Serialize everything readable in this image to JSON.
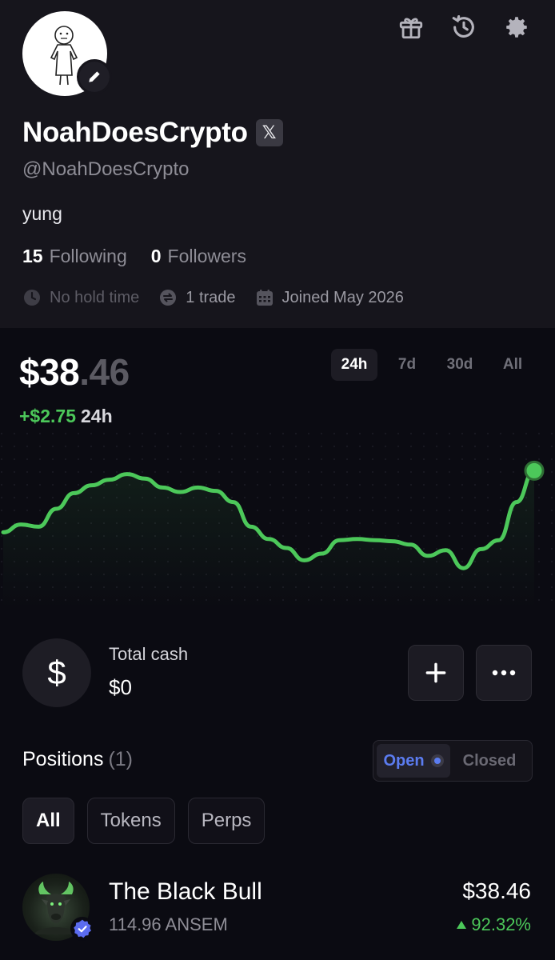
{
  "profile": {
    "name": "NoahDoesCrypto",
    "x_badge": "𝕏",
    "handle": "@NoahDoesCrypto",
    "bio": "yung",
    "following_count": "15",
    "following_label": "Following",
    "followers_count": "0",
    "followers_label": "Followers",
    "meta": {
      "hold_time": "No hold time",
      "trades": "1 trade",
      "joined": "Joined May 2026"
    },
    "icons": [
      "gift-icon",
      "history-icon",
      "gear-icon"
    ]
  },
  "portfolio": {
    "balance_whole": "$38",
    "balance_decimal": ".46",
    "change_value": "+$2.75",
    "change_period": "24h",
    "ranges": [
      "24h",
      "7d",
      "30d",
      "All"
    ],
    "selected_range": "24h",
    "line_color": "#4cc85a"
  },
  "chart_data": {
    "type": "line",
    "series": [
      {
        "values": [
          30.9,
          31.6,
          31.4,
          33.0,
          34.4,
          35.1,
          35.6,
          36.1,
          35.7,
          34.9,
          34.5,
          34.9,
          34.6,
          33.6,
          31.4,
          30.3,
          29.5,
          28.4,
          29.0,
          30.2,
          30.3,
          30.2,
          30.1,
          29.8,
          28.8,
          29.3,
          27.7,
          29.4,
          30.2,
          33.6,
          36.4
        ]
      }
    ]
  },
  "cash": {
    "label": "Total cash",
    "value": "$0",
    "icon_symbol": "$"
  },
  "positions": {
    "title": "Positions",
    "count": "(1)",
    "toggle_open": "Open",
    "toggle_closed": "Closed",
    "filters": [
      "All",
      "Tokens",
      "Perps"
    ],
    "items": [
      {
        "name": "The Black Bull",
        "amount": "114.96 ANSEM",
        "value": "$38.46",
        "change": "92.32%"
      }
    ]
  }
}
